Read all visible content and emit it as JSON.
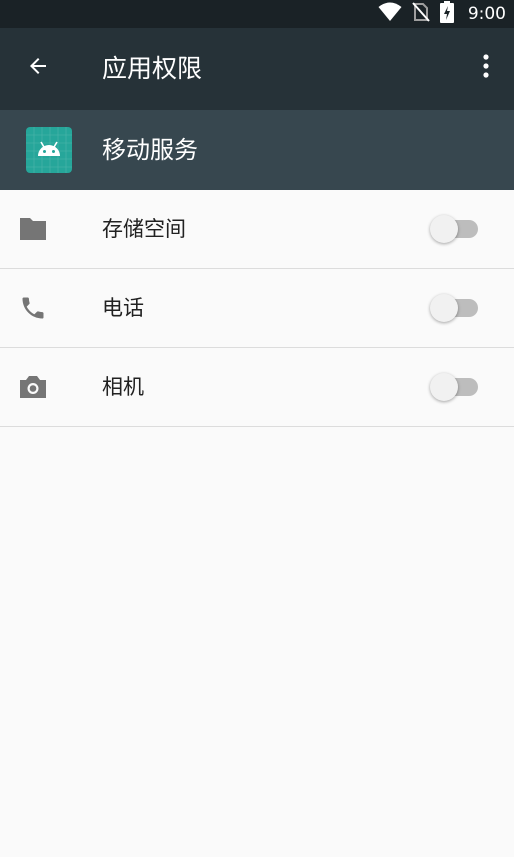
{
  "status_bar": {
    "time": "9:00",
    "icons": [
      "wifi-icon",
      "no-sim-icon",
      "battery-charging-icon"
    ]
  },
  "app_bar": {
    "title": "应用权限",
    "back_icon": "arrow-back-icon",
    "overflow_icon": "more-vert-icon"
  },
  "app_header": {
    "app_name": "移动服务",
    "app_icon": "android-icon"
  },
  "permissions": [
    {
      "label": "存储空间",
      "icon": "folder-icon",
      "enabled": false
    },
    {
      "label": "电话",
      "icon": "phone-icon",
      "enabled": false
    },
    {
      "label": "相机",
      "icon": "camera-icon",
      "enabled": false
    }
  ],
  "colors": {
    "status_bar": "#1a2226",
    "app_bar": "#263238",
    "app_header": "#37474f",
    "app_icon_bg": "#26a69a",
    "background": "#fafafa",
    "icon_gray": "#757575"
  }
}
